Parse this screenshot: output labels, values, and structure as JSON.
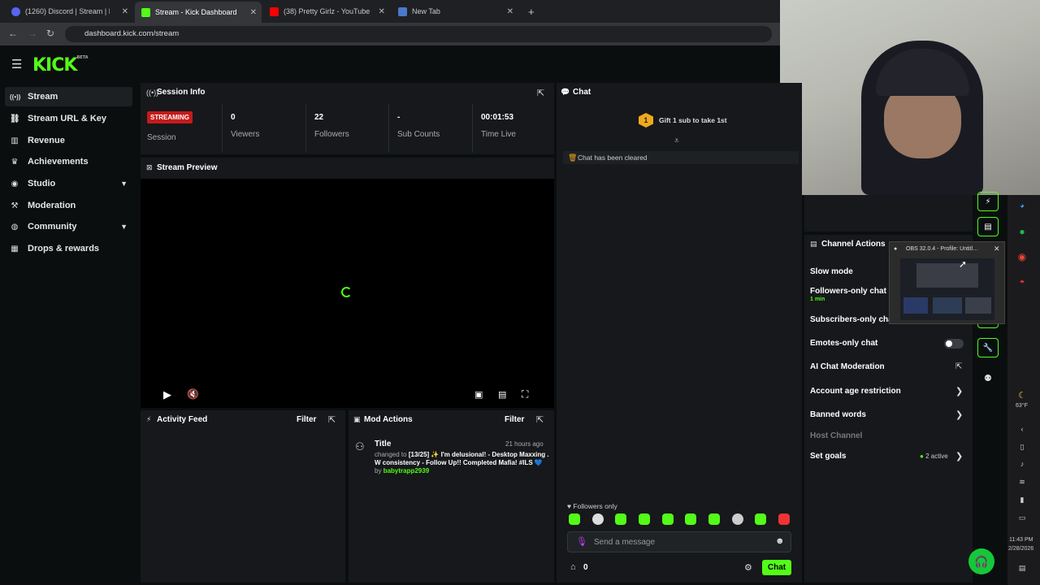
{
  "browser": {
    "tabs": [
      {
        "title": "(1260) Discord | Stream | B…",
        "color": "#5865f2"
      },
      {
        "title": "Stream - Kick Dashboard",
        "color": "#53fc18"
      },
      {
        "title": "(38) Pretty Girlz - YouTube",
        "color": "#ff0000"
      },
      {
        "title": "New Tab",
        "color": "#4a79c9"
      }
    ],
    "new_tab": "+",
    "url": "dashboard.kick.com/stream"
  },
  "logo": {
    "text": "KICK",
    "tag": "BETA"
  },
  "sidebar": {
    "items": [
      {
        "label": "Stream",
        "icon": "broadcast-icon",
        "glyph": "((•))"
      },
      {
        "label": "Stream URL & Key",
        "icon": "link-icon",
        "glyph": "🔗"
      },
      {
        "label": "Revenue",
        "icon": "chart-icon",
        "glyph": "▥"
      },
      {
        "label": "Achievements",
        "icon": "trophy-icon",
        "glyph": "🏆"
      },
      {
        "label": "Studio",
        "icon": "palette-icon",
        "glyph": "🎨"
      },
      {
        "label": "Moderation",
        "icon": "hammer-icon",
        "glyph": "🔨"
      },
      {
        "label": "Community",
        "icon": "globe-icon",
        "glyph": "🌐"
      },
      {
        "label": "Drops & rewards",
        "icon": "gift-icon",
        "glyph": "▦"
      }
    ]
  },
  "session": {
    "title": "Session Info",
    "status": "STREAMING",
    "status_label": "Session",
    "stats": [
      {
        "value": "0",
        "label": "Viewers"
      },
      {
        "value": "22",
        "label": "Followers"
      },
      {
        "value": "-",
        "label": "Sub Counts"
      },
      {
        "value": "00:01:53",
        "label": "Time Live"
      }
    ]
  },
  "preview": {
    "title": "Stream Preview"
  },
  "activity": {
    "title": "Activity Feed",
    "filter": "Filter"
  },
  "mod_actions": {
    "title": "Mod Actions",
    "filter": "Filter",
    "entry": {
      "heading": "Title",
      "time": "21 hours ago",
      "prefix": "changed to",
      "text": "[13/25] ✨ I'm delusional! - Desktop Maxxing . W consistency - Follow Up!! Completed Mafia! #ILS 💙",
      "by": "by",
      "user": "babytrapp2939"
    }
  },
  "chat": {
    "title": "Chat",
    "gift_badge": "1",
    "gift_text": "Gift 1 sub to take 1st",
    "cleared": "Chat has been cleared",
    "followers_only": "Followers only",
    "placeholder": "Send a message",
    "count": "0",
    "send": "Chat"
  },
  "channel_actions": {
    "title": "Channel Actions",
    "slow_mode": "Slow mode",
    "followers_only": "Followers-only chat",
    "followers_time": "1 min",
    "subscribers_only": "Subscribers-only chat",
    "emotes_only": "Emotes-only chat",
    "ai_moderation": "AI Chat Moderation",
    "age_restriction": "Account age restriction",
    "banned_words": "Banned words",
    "host_channel": "Host Channel",
    "set_goals": "Set goals",
    "goals_active": "2 active"
  },
  "obs_popup": {
    "title": "OBS 32.0.4 - Profile: Untitl…"
  },
  "tray": {
    "weather": "63°F",
    "time": "11:43 PM",
    "date": "2/28/2026"
  },
  "colors": {
    "accent": "#53fc18",
    "live": "#c61a1a",
    "panel": "#16181b"
  }
}
